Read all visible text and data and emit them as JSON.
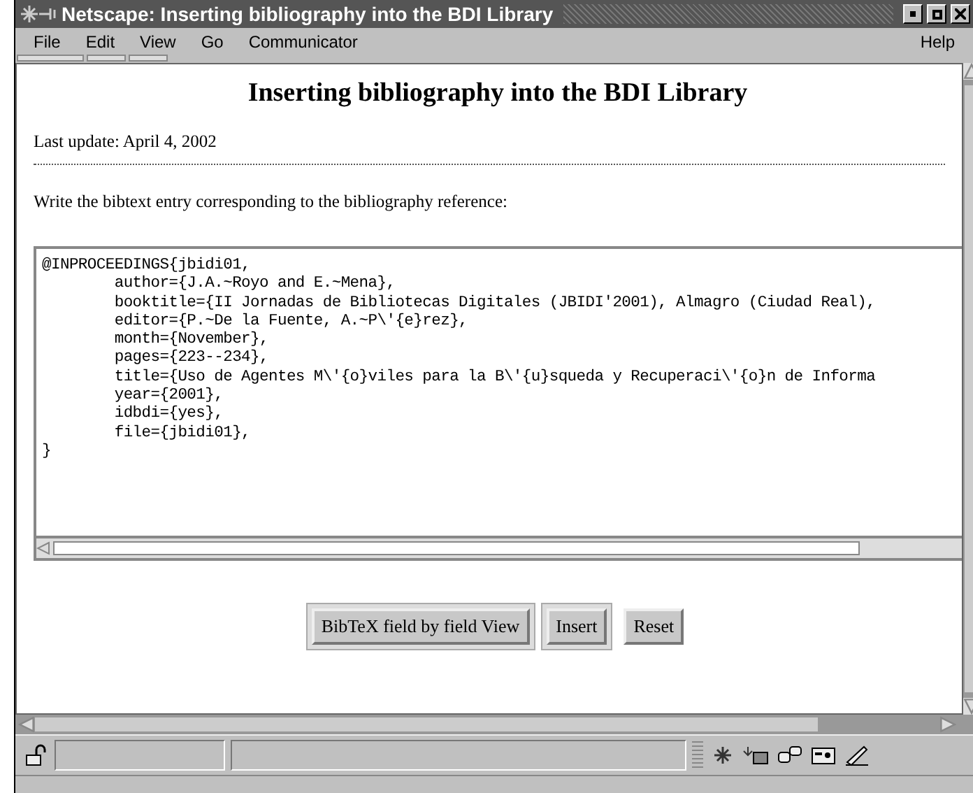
{
  "window": {
    "title": "Netscape: Inserting bibliography into the BDI Library"
  },
  "menu": {
    "left": [
      "File",
      "Edit",
      "View",
      "Go",
      "Communicator"
    ],
    "right": "Help"
  },
  "page": {
    "heading": "Inserting bibliography into the BDI Library",
    "last_update": "Last update: April 4, 2002",
    "instruction": "Write the bibtext entry corresponding to the bibliography reference:",
    "entry_lines": [
      "@INPROCEEDINGS{jbidi01,",
      "        author={J.A.~Royo and E.~Mena},",
      "        booktitle={II Jornadas de Bibliotecas Digitales (JBIDI'2001), Almagro (Ciudad Real),",
      "        editor={P.~De la Fuente, A.~P\\'{e}rez},",
      "        month={November},",
      "        pages={223--234},",
      "        title={Uso de Agentes M\\'{o}viles para la B\\'{u}squeda y Recuperaci\\'{o}n de Informa",
      "        year={2001},",
      "        idbdi={yes},",
      "        file={jbidi01},",
      "}"
    ],
    "buttons": [
      {
        "label": "BibTeX field by field View",
        "framed": true
      },
      {
        "label": "Insert",
        "framed": true
      },
      {
        "label": "Reset",
        "framed": false
      }
    ]
  }
}
